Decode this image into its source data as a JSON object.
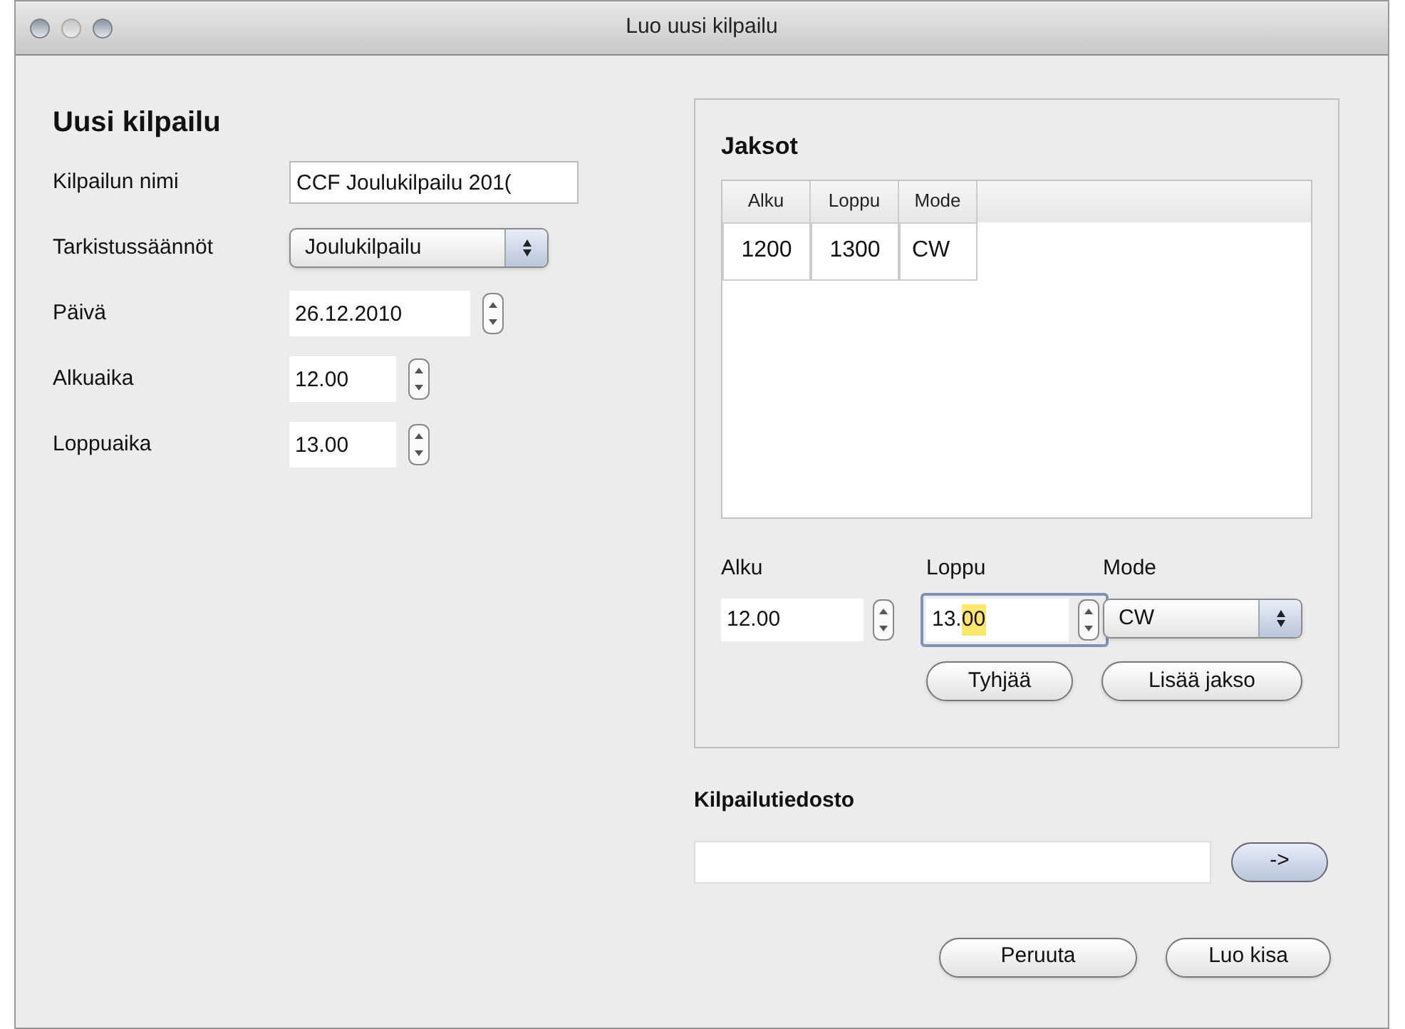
{
  "window": {
    "title": "Luo uusi kilpailu"
  },
  "competition": {
    "heading": "Uusi kilpailu",
    "fields": [
      {
        "kind": "text",
        "label": "Kilpailun nimi",
        "value": "CCF Joulukilpailu 201("
      },
      {
        "kind": "select",
        "label": "Tarkistussäännöt",
        "value": "Joulukilpailu"
      },
      {
        "kind": "date",
        "label": "Päivä",
        "value": "26.12.2010"
      },
      {
        "kind": "time",
        "label": "Alkuaika",
        "value": "12.00"
      },
      {
        "kind": "time",
        "label": "Loppuaika",
        "value": "13.00"
      }
    ]
  },
  "periods": {
    "heading": "Jaksot",
    "table": {
      "columns": [
        "Alku",
        "Loppu",
        "Mode"
      ],
      "rows": [
        [
          "1200",
          "1300",
          "CW"
        ]
      ]
    },
    "editor": {
      "start": {
        "label": "Alku",
        "text": "12.00",
        "focused": false
      },
      "end": {
        "label": "Loppu",
        "text": "13.",
        "selected_text": "00",
        "focused": true
      },
      "mode": {
        "label": "Mode",
        "value": "CW"
      }
    },
    "buttons": [
      "Tyhjää",
      "Lisää jakso"
    ]
  },
  "file": {
    "heading": "Kilpailutiedosto",
    "browse_button": "->"
  },
  "buttons": [
    "Peruuta",
    "Luo kisa"
  ]
}
